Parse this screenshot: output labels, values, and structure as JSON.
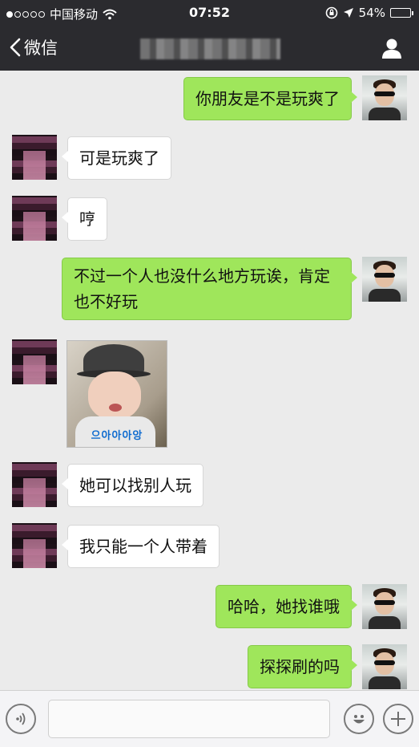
{
  "status_bar": {
    "carrier": "中国移动",
    "time": "07:52",
    "battery_percent": "54%",
    "battery_level": 0.54
  },
  "nav": {
    "back_label": "微信",
    "title": "",
    "profile_icon": "person-icon"
  },
  "messages": [
    {
      "side": "out",
      "type": "text",
      "text": "你朋友是不是玩爽了"
    },
    {
      "side": "in",
      "type": "text",
      "text": "可是玩爽了"
    },
    {
      "side": "in",
      "type": "text",
      "text": "哼"
    },
    {
      "side": "out",
      "type": "text",
      "text": "不过一个人也没什么地方玩诶，肯定也不好玩"
    },
    {
      "side": "in",
      "type": "sticker",
      "caption": "으아아아앙"
    },
    {
      "side": "in",
      "type": "text",
      "text": "她可以找别人玩"
    },
    {
      "side": "in",
      "type": "text",
      "text": "我只能一个人带着"
    },
    {
      "side": "out",
      "type": "text",
      "text": "哈哈，她找谁哦"
    },
    {
      "side": "out",
      "type": "text",
      "text": "探探刷的吗"
    }
  ],
  "input_bar": {
    "voice_icon": "voice-icon",
    "emoji_icon": "smiley-icon",
    "plus_icon": "plus-icon",
    "placeholder": ""
  },
  "colors": {
    "bar_bg": "#2b2b2f",
    "chat_bg": "#ebebeb",
    "outgoing_bubble": "#9fe65b",
    "incoming_bubble": "#ffffff"
  }
}
